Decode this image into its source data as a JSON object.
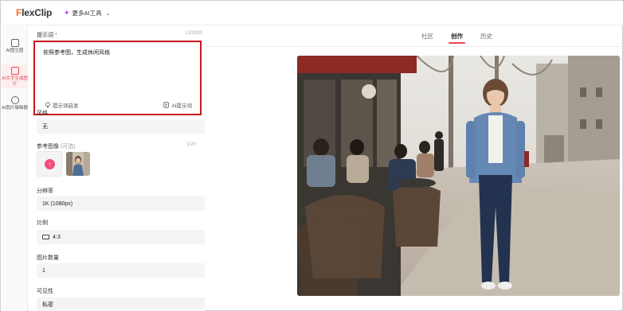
{
  "app": {
    "logo": "FlexClip",
    "logo_first": "F",
    "logo_rest": "lexClip",
    "ai_tools_label": "更多AI工具"
  },
  "rail": {
    "items": [
      {
        "label": "AI图生图",
        "icon": "image-swap-icon",
        "active": false
      },
      {
        "label": "AI文字生成图片",
        "icon": "text-to-image-icon",
        "active": true
      },
      {
        "label": "AI图片编辑器",
        "icon": "image-editor-icon",
        "active": false
      }
    ]
  },
  "panel": {
    "prompt_label": "提示词",
    "prompt_required": "*",
    "prompt_count": "12/3000",
    "prompt_value": "依照参考图，生成休闲风格",
    "inspire_label": "提示词启发",
    "ai_prompt_label": "AI提示词",
    "style_label": "风格",
    "style_value": "无",
    "ref_label": "参考图像",
    "ref_optional": "(可选)",
    "ref_count": "1/20",
    "resolution_label": "分辨率",
    "resolution_value": "1K (1080px)",
    "ratio_label": "比例",
    "ratio_value": "4:3",
    "count_label": "图片数量",
    "count_value": "1",
    "visibility_label": "可见性",
    "visibility_value": "私密"
  },
  "tabs": [
    {
      "label": "社区",
      "active": false
    },
    {
      "label": "创作",
      "active": true
    },
    {
      "label": "历史",
      "active": false
    }
  ],
  "colors": {
    "accent": "#e8484e",
    "highlight_border": "#c8171d",
    "logo_orange": "#ff6a1f"
  }
}
